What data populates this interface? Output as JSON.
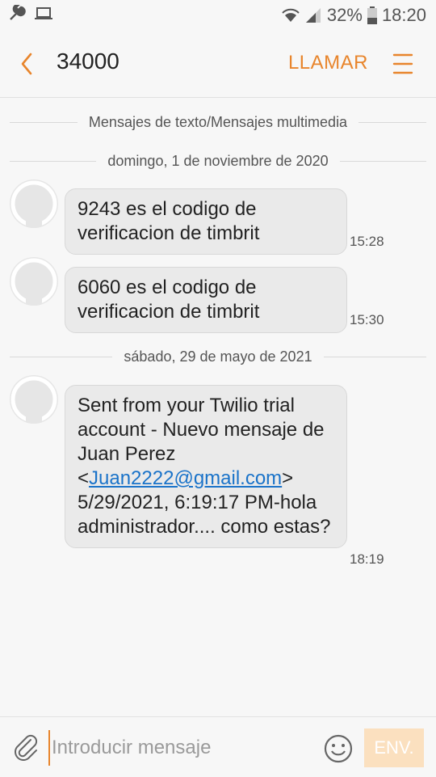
{
  "status_bar": {
    "battery_percent": "32%",
    "time": "18:20",
    "icons": [
      "wrench-icon",
      "laptop-icon",
      "wifi-icon",
      "signal-icon",
      "battery-icon"
    ]
  },
  "header": {
    "title": "34000",
    "call_label": "LLAMAR",
    "icons": [
      "back-chevron-icon",
      "menu-icon"
    ]
  },
  "conversation": {
    "thread_type": "Mensajes de texto/Mensajes multimedia",
    "groups": [
      {
        "date": "domingo, 1 de noviembre de 2020",
        "messages": [
          {
            "text": "9243 es el codigo de verificacion de timbrit",
            "time": "15:28"
          },
          {
            "text": "6060 es el codigo de verificacion de timbrit",
            "time": "15:30"
          }
        ]
      },
      {
        "date": "sábado, 29 de mayo de 2021",
        "messages": [
          {
            "text_before": "Sent from your Twilio trial account - Nuevo mensaje de Juan Perez <",
            "link": "Juan2222@gmail.com",
            "text_after": "> 5/29/2021, 6:19:17 PM-hola administrador.... como estas?",
            "time": "18:19"
          }
        ]
      }
    ]
  },
  "composer": {
    "placeholder": "Introducir mensaje",
    "send_label": "ENV.",
    "icons": [
      "paperclip-icon",
      "emoji-icon"
    ]
  },
  "colors": {
    "accent": "#e8852c",
    "send_disabled_bg": "#fbe0bf",
    "bubble_bg": "#eaeaea",
    "link": "#1a73c9"
  }
}
